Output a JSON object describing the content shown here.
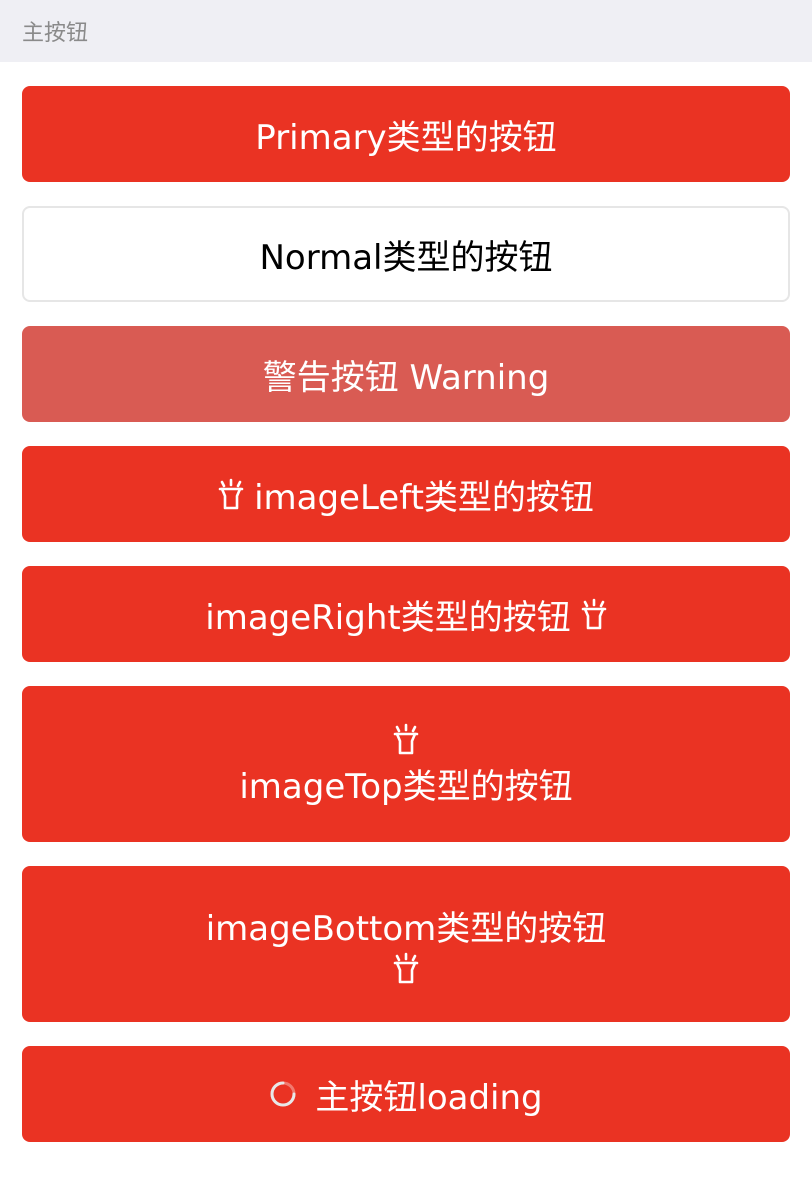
{
  "section": {
    "title": "主按钮"
  },
  "buttons": {
    "primary": "Primary类型的按钮",
    "normal": "Normal类型的按钮",
    "warning": "警告按钮 Warning",
    "image_left": "imageLeft类型的按钮",
    "image_right": "imageRight类型的按钮",
    "image_top": "imageTop类型的按钮",
    "image_bottom": "imageBottom类型的按钮",
    "loading": "主按钮loading"
  },
  "icons": {
    "lamp": "lamp-icon",
    "spinner": "loading-spinner-icon"
  },
  "colors": {
    "primary": "#ea3323",
    "warning": "#d95b53",
    "header_bg": "#efeff4",
    "header_text": "#8a8a8a"
  }
}
